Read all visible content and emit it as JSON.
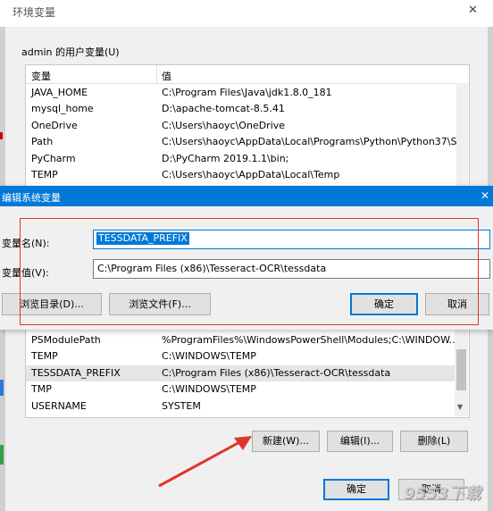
{
  "env_window": {
    "title": "环境变量",
    "close_glyph": "✕",
    "user_group_label": "admin 的用户变量(U)",
    "user_table": {
      "headers": [
        "变量",
        "值"
      ],
      "rows": [
        {
          "name": "JAVA_HOME",
          "value": "C:\\Program Files\\Java\\jdk1.8.0_181"
        },
        {
          "name": "mysql_home",
          "value": "D:\\apache-tomcat-8.5.41"
        },
        {
          "name": "OneDrive",
          "value": "C:\\Users\\haoyc\\OneDrive"
        },
        {
          "name": "Path",
          "value": "C:\\Users\\haoyc\\AppData\\Local\\Programs\\Python\\Python37\\S..."
        },
        {
          "name": "PyCharm",
          "value": "D:\\PyCharm 2019.1.1\\bin;"
        },
        {
          "name": "TEMP",
          "value": "C:\\Users\\haoyc\\AppData\\Local\\Temp"
        }
      ]
    },
    "system_table": {
      "rows": [
        {
          "name": "PSModulePath",
          "value": "%ProgramFiles%\\WindowsPowerShell\\Modules;C:\\WINDOW..."
        },
        {
          "name": "TEMP",
          "value": "C:\\WINDOWS\\TEMP"
        },
        {
          "name": "TESSDATA_PREFIX",
          "value": "C:\\Program Files (x86)\\Tesseract-OCR\\tessdata"
        },
        {
          "name": "TMP",
          "value": "C:\\WINDOWS\\TEMP"
        },
        {
          "name": "USERNAME",
          "value": "SYSTEM"
        }
      ]
    },
    "system_buttons": {
      "new": "新建(W)...",
      "edit": "编辑(I)...",
      "delete": "删除(L)"
    },
    "footer_buttons": {
      "ok": "确定",
      "cancel": "取消"
    }
  },
  "edit_dialog": {
    "title": "编辑系统变量",
    "close_glyph": "✕",
    "name_label": "变量名(N):",
    "name_value": "TESSDATA_PREFIX",
    "value_label": "变量值(V):",
    "value_value": "C:\\Program Files (x86)\\Tesseract-OCR\\tessdata",
    "browse_dir_label": "浏览目录(D)...",
    "browse_file_label": "浏览文件(F)...",
    "ok_label": "确定",
    "cancel_label": "取消"
  },
  "watermark": "9553下载",
  "colors": {
    "accent": "#0078d7",
    "highlight_box": "#e0352e",
    "arrow": "#e0352e",
    "selection": "#0078d7"
  }
}
